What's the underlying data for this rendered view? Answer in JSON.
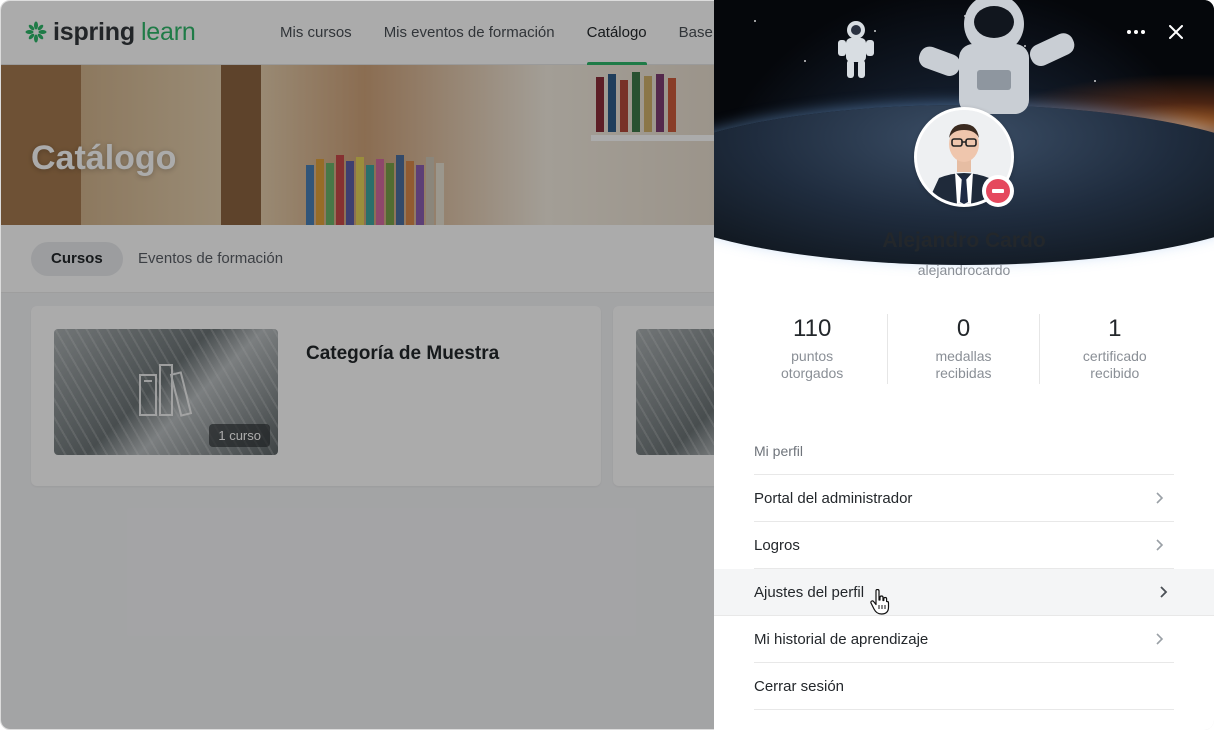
{
  "app": {
    "logo": {
      "brand": "ispring",
      "product": "learn",
      "brand_color": "#34383d",
      "product_color": "#2fb86a"
    },
    "nav": [
      {
        "label": "Mis cursos",
        "active": false
      },
      {
        "label": "Mis eventos de formación",
        "active": false
      },
      {
        "label": "Catálogo",
        "active": true
      },
      {
        "label": "Base",
        "active": false
      }
    ],
    "hero_title": "Catálogo",
    "tabs": [
      {
        "label": "Cursos",
        "active": true
      },
      {
        "label": "Eventos de formación",
        "active": false
      }
    ],
    "cards": [
      {
        "title": "Categoría de Muestra",
        "badge": "1 curso",
        "icon": "books-icon"
      },
      {
        "title": "",
        "badge": "",
        "icon": ""
      }
    ]
  },
  "profile": {
    "name": "Alejandro Cardo",
    "username": "alejandrocardo",
    "status_color": "#e5485d",
    "stats": [
      {
        "value": "110",
        "label_line1": "puntos",
        "label_line2": "otorgados"
      },
      {
        "value": "0",
        "label_line1": "medallas",
        "label_line2": "recibidas"
      },
      {
        "value": "1",
        "label_line1": "certificado",
        "label_line2": "recibido"
      }
    ],
    "menu_header": "Mi perfil",
    "menu": [
      {
        "label": "Portal del administrador",
        "chevron": true
      },
      {
        "label": "Logros",
        "chevron": true
      },
      {
        "label": "Ajustes del perfil",
        "chevron": true,
        "hovered": true
      },
      {
        "label": "Mi historial de aprendizaje",
        "chevron": true
      },
      {
        "label": "Cerrar sesión",
        "chevron": false
      }
    ]
  }
}
